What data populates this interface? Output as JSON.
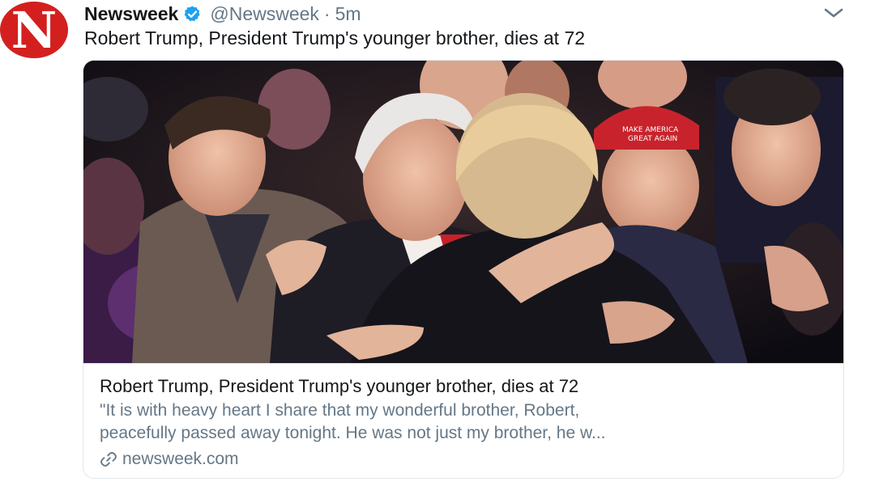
{
  "account": {
    "avatar_letter": "N",
    "display_name": "Newsweek",
    "handle": "@Newsweek",
    "separator": "·",
    "time": "5m",
    "verified_icon": "verified-badge-icon",
    "brand_color": "#d3201f",
    "verified_color": "#1da1f2"
  },
  "tweet": {
    "text": "Robert Trump, President Trump's younger brother, dies at 72",
    "menu_icon": "chevron-down-icon"
  },
  "card": {
    "image_icon": "news-photo",
    "title": "Robert Trump, President Trump's younger brother, dies at 72",
    "description_line1": "\"It is with heavy heart I share that my wonderful brother, Robert,",
    "description_line2": "peacefully passed away tonight. He was not just my brother, he w...",
    "domain_icon": "link-icon",
    "domain": "newsweek.com",
    "cap_text_line1": "MAKE AMERICA",
    "cap_text_line2": "GREAT AGAIN"
  }
}
